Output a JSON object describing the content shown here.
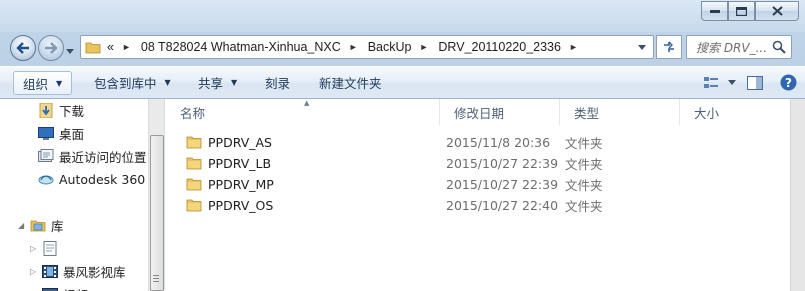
{
  "window": {
    "controls": {
      "minimize_icon": "minimize-icon",
      "maximize_icon": "maximize-icon",
      "close_icon": "close-icon"
    }
  },
  "address": {
    "overflow_marker": "«",
    "crumbs": [
      "08 T828024 Whatman-Xinhua_NXC",
      "BackUp",
      "DRV_20110220_2336"
    ],
    "search_placeholder": "搜索 DRV_..."
  },
  "toolbar": {
    "organize": "组织",
    "include_in_library": "包含到库中",
    "share": "共享",
    "burn": "刻录",
    "new_folder": "新建文件夹"
  },
  "nav_pane": {
    "items": [
      {
        "label": "下载",
        "icon": "downloads-icon"
      },
      {
        "label": "桌面",
        "icon": "desktop-icon"
      },
      {
        "label": "最近访问的位置",
        "icon": "recent-places-icon"
      },
      {
        "label": "Autodesk 360",
        "icon": "autodesk-cloud-icon"
      },
      {
        "label": "库",
        "icon": "libraries-icon"
      },
      {
        "label": "",
        "icon": "library-document-icon"
      },
      {
        "label": "暴风影视库",
        "icon": "video-library-icon"
      },
      {
        "label": "视频",
        "icon": "video-icon"
      }
    ]
  },
  "file_list": {
    "columns": {
      "name": "名称",
      "date": "修改日期",
      "type": "类型",
      "size": "大小"
    },
    "rows": [
      {
        "name": "PPDRV_AS",
        "date": "2015/11/8 20:36",
        "type": "文件夹"
      },
      {
        "name": "PPDRV_LB",
        "date": "2015/10/27 22:39",
        "type": "文件夹"
      },
      {
        "name": "PPDRV_MP",
        "date": "2015/10/27 22:39",
        "type": "文件夹"
      },
      {
        "name": "PPDRV_OS",
        "date": "2015/10/27 22:40",
        "type": "文件夹"
      }
    ]
  },
  "colors": {
    "folder": "#e9c35c",
    "toolbar_text": "#1e395b",
    "header_text": "#4c607a",
    "meta_text": "#6d6d6d"
  }
}
